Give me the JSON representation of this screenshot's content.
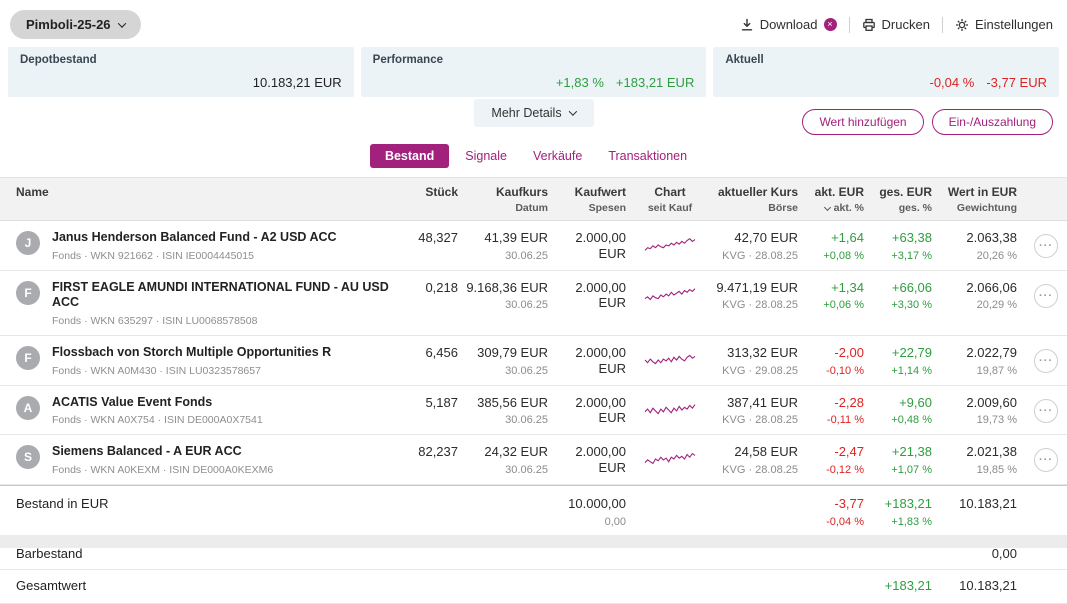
{
  "colors": {
    "accent": "#a1217c",
    "green": "#2e9e3f",
    "red": "#dc2323"
  },
  "header": {
    "portfolio_selector": "Pimboli-25-26",
    "actions": [
      {
        "label": "Download",
        "icon": "download-icon"
      },
      {
        "label": "Drucken",
        "icon": "printer-icon"
      },
      {
        "label": "Einstellungen",
        "icon": "gear-icon"
      }
    ]
  },
  "summary_cards": [
    {
      "label": "Depotbestand",
      "values": [
        "10.183,21 EUR"
      ]
    },
    {
      "label": "Performance",
      "values": [
        "+1,83 %",
        "+183,21 EUR"
      ]
    },
    {
      "label": "Aktuell",
      "values": [
        "-0,04 %",
        "-3,77 EUR"
      ]
    }
  ],
  "buttons": {
    "more_details": "Mehr Details",
    "add_value": "Wert hinzufügen",
    "deposit_withdraw": "Ein-/Auszahlung"
  },
  "tabs": [
    {
      "label": "Bestand",
      "active": true
    },
    {
      "label": "Signale",
      "active": false
    },
    {
      "label": "Verkäufe",
      "active": false
    },
    {
      "label": "Transaktionen",
      "active": false
    }
  ],
  "table": {
    "header": {
      "name": "Name",
      "stueck": "Stück",
      "kaufkurs": "Kaufkurs",
      "datum": "Datum",
      "kaufwert": "Kaufwert",
      "spesen": "Spesen",
      "chart": "Chart",
      "seit_kauf": "seit Kauf",
      "kurs": "aktueller Kurs",
      "boerse": "Börse",
      "akt_eur": "akt. EUR",
      "akt_pct": "akt. %",
      "ges_eur": "ges. EUR",
      "ges_pct": "ges. %",
      "wert": "Wert in EUR",
      "gewichtung": "Gewichtung"
    },
    "rows": [
      {
        "initial": "J",
        "name": "Janus Henderson Balanced Fund - A2 USD ACC",
        "meta": "Fonds · WKN 921662 · ISIN IE0004445015",
        "stueck": "48,327",
        "kaufkurs": "41,39 EUR",
        "datum": "30.06.25",
        "kaufwert": "2.000,00 EUR",
        "spesen": "",
        "kurs": "42,70 EUR",
        "boerse": "KVG · 28.08.25",
        "akt_eur": "+1,64",
        "akt_pct": "+0,08 %",
        "ges_eur": "+63,38",
        "ges_pct": "+3,17 %",
        "wert": "2.063,38",
        "gewichtung": "20,26 %",
        "spark": [
          0.2,
          0.35,
          0.3,
          0.45,
          0.35,
          0.5,
          0.4,
          0.35,
          0.5,
          0.45,
          0.6,
          0.5,
          0.65,
          0.55,
          0.7,
          0.6,
          0.75,
          0.85,
          0.7,
          0.8
        ]
      },
      {
        "initial": "F",
        "name": "FIRST EAGLE AMUNDI INTERNATIONAL FUND - AU USD ACC",
        "meta": "Fonds · WKN 635297 · ISIN LU0068578508",
        "stueck": "0,218",
        "kaufkurs": "9.168,36 EUR",
        "datum": "30.06.25",
        "kaufwert": "2.000,00 EUR",
        "spesen": "",
        "kurs": "9.471,19 EUR",
        "boerse": "KVG · 28.08.25",
        "akt_eur": "+1,34",
        "akt_pct": "+0,06 %",
        "ges_eur": "+66,06",
        "ges_pct": "+3,30 %",
        "wert": "2.066,06",
        "gewichtung": "20,29 %",
        "spark": [
          0.3,
          0.4,
          0.25,
          0.45,
          0.35,
          0.3,
          0.5,
          0.4,
          0.55,
          0.45,
          0.65,
          0.5,
          0.6,
          0.7,
          0.55,
          0.75,
          0.65,
          0.8,
          0.7,
          0.85
        ]
      },
      {
        "initial": "F",
        "name": "Flossbach von Storch Multiple Opportunities R",
        "meta": "Fonds · WKN A0M430 · ISIN LU0323578657",
        "stueck": "6,456",
        "kaufkurs": "309,79 EUR",
        "datum": "30.06.25",
        "kaufwert": "2.000,00 EUR",
        "spesen": "",
        "kurs": "313,32 EUR",
        "boerse": "KVG · 29.08.25",
        "akt_eur": "-2,00",
        "akt_pct": "-0,10 %",
        "ges_eur": "+22,79",
        "ges_pct": "+1,14 %",
        "wert": "2.022,79",
        "gewichtung": "19,87 %",
        "spark": [
          0.5,
          0.35,
          0.55,
          0.4,
          0.3,
          0.5,
          0.35,
          0.55,
          0.45,
          0.6,
          0.4,
          0.65,
          0.5,
          0.7,
          0.55,
          0.45,
          0.65,
          0.75,
          0.6,
          0.7
        ]
      },
      {
        "initial": "A",
        "name": "ACATIS Value Event Fonds",
        "meta": "Fonds · WKN A0X754 · ISIN DE000A0X7541",
        "stueck": "5,187",
        "kaufkurs": "385,56 EUR",
        "datum": "30.06.25",
        "kaufwert": "2.000,00 EUR",
        "spesen": "",
        "kurs": "387,41 EUR",
        "boerse": "KVG · 28.08.25",
        "akt_eur": "-2,28",
        "akt_pct": "-0,11 %",
        "ges_eur": "+9,60",
        "ges_pct": "+0,48 %",
        "wert": "2.009,60",
        "gewichtung": "19,73 %",
        "spark": [
          0.4,
          0.55,
          0.35,
          0.6,
          0.45,
          0.3,
          0.55,
          0.4,
          0.65,
          0.5,
          0.35,
          0.6,
          0.45,
          0.7,
          0.5,
          0.65,
          0.55,
          0.75,
          0.6,
          0.8
        ]
      },
      {
        "initial": "S",
        "name": "Siemens Balanced - A EUR ACC",
        "meta": "Fonds · WKN A0KEXM · ISIN DE000A0KEXM6",
        "stueck": "82,237",
        "kaufkurs": "24,32 EUR",
        "datum": "30.06.25",
        "kaufwert": "2.000,00 EUR",
        "spesen": "",
        "kurs": "24,58 EUR",
        "boerse": "KVG · 28.08.25",
        "akt_eur": "-2,47",
        "akt_pct": "-0,12 %",
        "ges_eur": "+21,38",
        "ges_pct": "+1,07 %",
        "wert": "2.021,38",
        "gewichtung": "19,85 %",
        "spark": [
          0.3,
          0.45,
          0.35,
          0.25,
          0.5,
          0.4,
          0.6,
          0.45,
          0.55,
          0.35,
          0.6,
          0.5,
          0.7,
          0.55,
          0.65,
          0.5,
          0.75,
          0.6,
          0.8,
          0.7
        ]
      }
    ]
  },
  "totals": {
    "bestand": {
      "label": "Bestand in EUR",
      "kaufwert": "10.000,00",
      "spesen": "0,00",
      "akt_eur": "-3,77",
      "akt_pct": "-0,04 %",
      "ges_eur": "+183,21",
      "ges_pct": "+1,83 %",
      "wert": "10.183,21"
    },
    "barbestand": {
      "label": "Barbestand",
      "wert": "0,00"
    },
    "gesamtwert": {
      "label": "Gesamtwert",
      "ges_eur": "+183,21",
      "wert": "10.183,21"
    }
  }
}
